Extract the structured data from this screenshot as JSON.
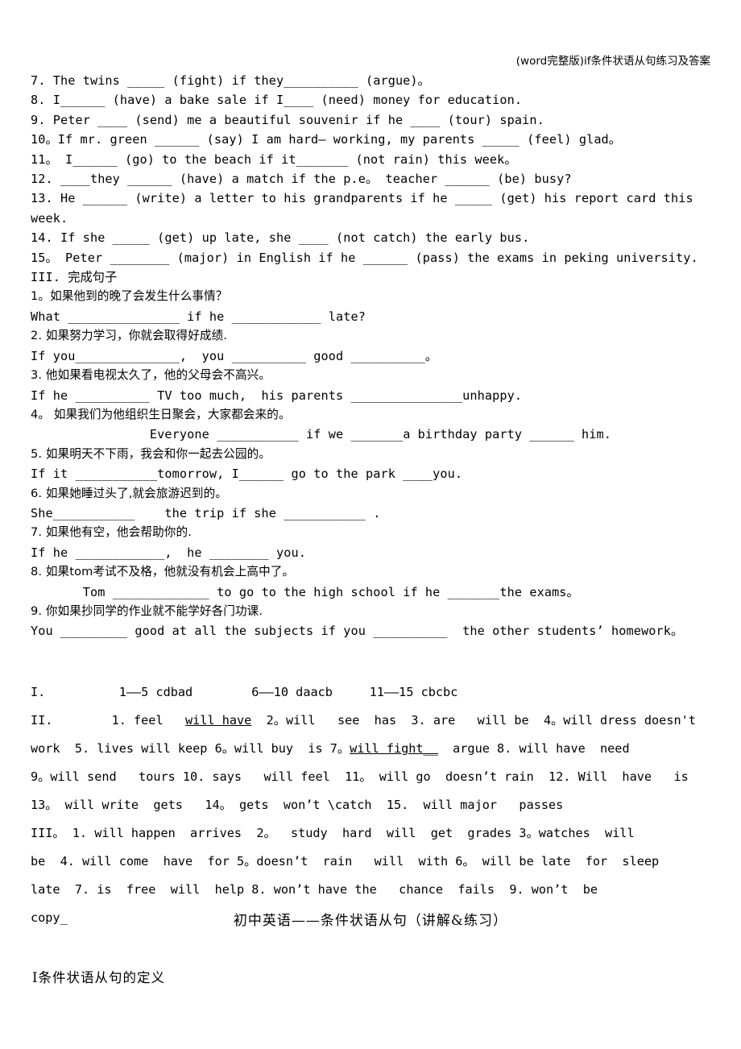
{
  "header": {
    "running_title": "(word完整版)if条件状语从句练习及答案"
  },
  "exercises": {
    "fill_in_blanks": [
      "7. The twins _____ (fight) if they__________ (argue)。",
      "8. I______ (have) a bake sale if I____ (need) money for education.",
      "9. Peter ____ (send) me a beautiful souvenir if he ____ (tour) spain.",
      "10。If mr. green ______ (say) I am hard— working, my parents _____ (feel) glad。",
      "11。 I______ (go) to the beach if it_______ (not rain) this week。",
      "12. ____they ______ (have) a match if the p.e。 teacher ______ (be) busy?",
      "13. He ______ (write) a letter to his grandparents if he _____ (get) his report card this week.",
      "14. If she _____ (get) up late, she ____ (not catch) the early bus.",
      "15。 Peter ________ (major) in English if he ______ (pass) the exams in peking university."
    ],
    "section3_heading": "III. 完成句子",
    "sentences": [
      {
        "cn": "1。如果他到的晚了会发生什么事情？",
        "en": "What _______________ if he ____________ late?"
      },
      {
        "cn": "2. 如果努力学习，你就会取得好成绩.",
        "en": "If you______________,  you __________ good __________。"
      },
      {
        "cn": "3. 他如果看电视太久了，他的父母会不高兴。",
        "en": "If he __________ TV too much,  his parents _______________unhappy."
      },
      {
        "cn": "4。 如果我们为他组织生日聚会，大家都会来的。",
        "en": "                Everyone ___________ if we _______a birthday party ______ him."
      },
      {
        "cn": "5. 如果明天不下雨，我会和你一起去公园的。",
        "en": "If it ___________tomorrow, I______ go to the park ____you."
      },
      {
        "cn": "6. 如果她睡过头了,就会旅游迟到的。",
        "en": "She___________    the trip if she ___________ ."
      },
      {
        "cn": "7. 如果他有空，他会帮助你的.",
        "en": "If he ____________,  he ________ you."
      },
      {
        "cn": "8. 如果tom考试不及格，他就没有机会上高中了。",
        "en": "       Tom _____________ to go to the high school if he _______the exams。"
      },
      {
        "cn": "9. 你如果抄同学的作业就不能学好各门功课.",
        "en": "You _________ good at all the subjects if you __________  the other students’ homework。"
      }
    ]
  },
  "answer_key": {
    "line1": "I.          1——5 cdbad        6——10 daacb     11——15 cbcbc",
    "line2_a": "II.        1. feel   ",
    "line2_u": "will have",
    "line2_b": "  2。will   see  has  3. are   will be  4。will dress doesn't",
    "line3_a": "work  5. lives will keep 6。will buy  is 7。",
    "line3_u": "will fight__",
    "line3_b": "  argue 8. will have  need",
    "line4": "9。will send   tours 10. says   will feel  11。 will go  doesn’t rain  12. Will  have   is",
    "line5": "13。 will write  gets   14。 gets  won’t \\catch  15.  will major   passes",
    "line6": "III。 1. will happen  arrives  2。  study  hard  will  get  grades 3。watches  will",
    "line7": "be  4. will come  have  for 5。doesn’t  rain   will  with 6。 will be late  for  sleep",
    "line8": "late  7. is  free  will  help 8. won’t have the   chance  fails  9. won’t  be",
    "line9": "copy_"
  },
  "footer": {
    "doc_title": "初中英语——条件状语从句（讲解&练习）",
    "section_heading": "I条件状语从句的定义"
  }
}
